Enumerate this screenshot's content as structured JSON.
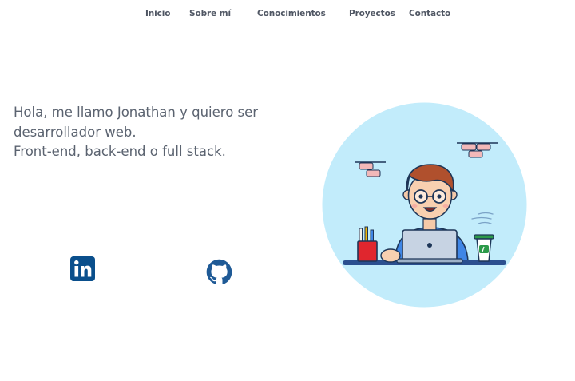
{
  "nav": {
    "items": [
      "Inicio",
      "Sobre mí",
      "Conocimientos",
      "Proyectos",
      "Contacto"
    ]
  },
  "intro": {
    "line1": "Hola, me llamo Jonathan y quiero ser",
    "line2": "desarrollador web.",
    "line3": "Front-end, back-end o full stack."
  },
  "social": {
    "linkedin_icon": "linkedin-icon",
    "github_icon": "github-icon",
    "linkedin_color": "#0a4f8c",
    "github_color": "#1f5a96"
  },
  "illustration": {
    "subject": "developer-at-laptop",
    "background_color": "#c2ecfb"
  }
}
